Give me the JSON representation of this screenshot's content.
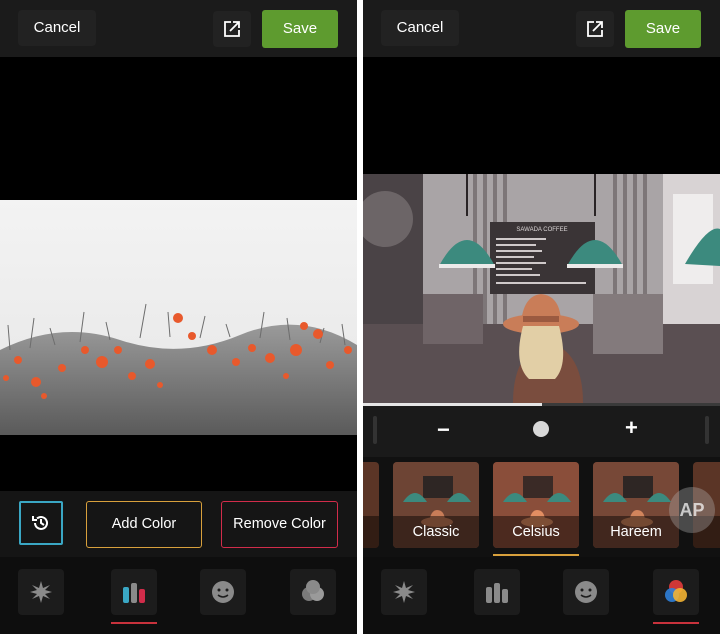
{
  "left": {
    "topbar": {
      "cancel_label": "Cancel",
      "save_label": "Save",
      "share_icon": "share-icon"
    },
    "tools": {
      "history_icon": "history-icon",
      "add_color_label": "Add Color",
      "remove_color_label": "Remove Color"
    },
    "tabs": [
      "sparkle-icon",
      "color-splash-icon",
      "face-icon",
      "blend-icon"
    ],
    "active_tab": 1
  },
  "right": {
    "topbar": {
      "cancel_label": "Cancel",
      "save_label": "Save",
      "share_icon": "share-icon"
    },
    "slider": {
      "minus_label": "−",
      "plus_label": "+",
      "value": 0.5
    },
    "cafe_sign": {
      "title": "SAWADA COFFEE"
    },
    "filters": [
      {
        "label": ""
      },
      {
        "label": "Classic"
      },
      {
        "label": "Celsius"
      },
      {
        "label": "Hareem"
      },
      {
        "label": ""
      }
    ],
    "selected_filter": "Celsius",
    "watermark": "AP",
    "tabs": [
      "sparkle-icon",
      "color-splash-icon",
      "face-icon",
      "rgb-circles-icon"
    ],
    "active_tab": 3
  },
  "colors": {
    "save_green": "#5e9b2f",
    "add_color_border": "#d8a03c",
    "remove_color_border": "#d12c4a",
    "history_border": "#3aa7c4",
    "tab_active": "#c8323c"
  }
}
